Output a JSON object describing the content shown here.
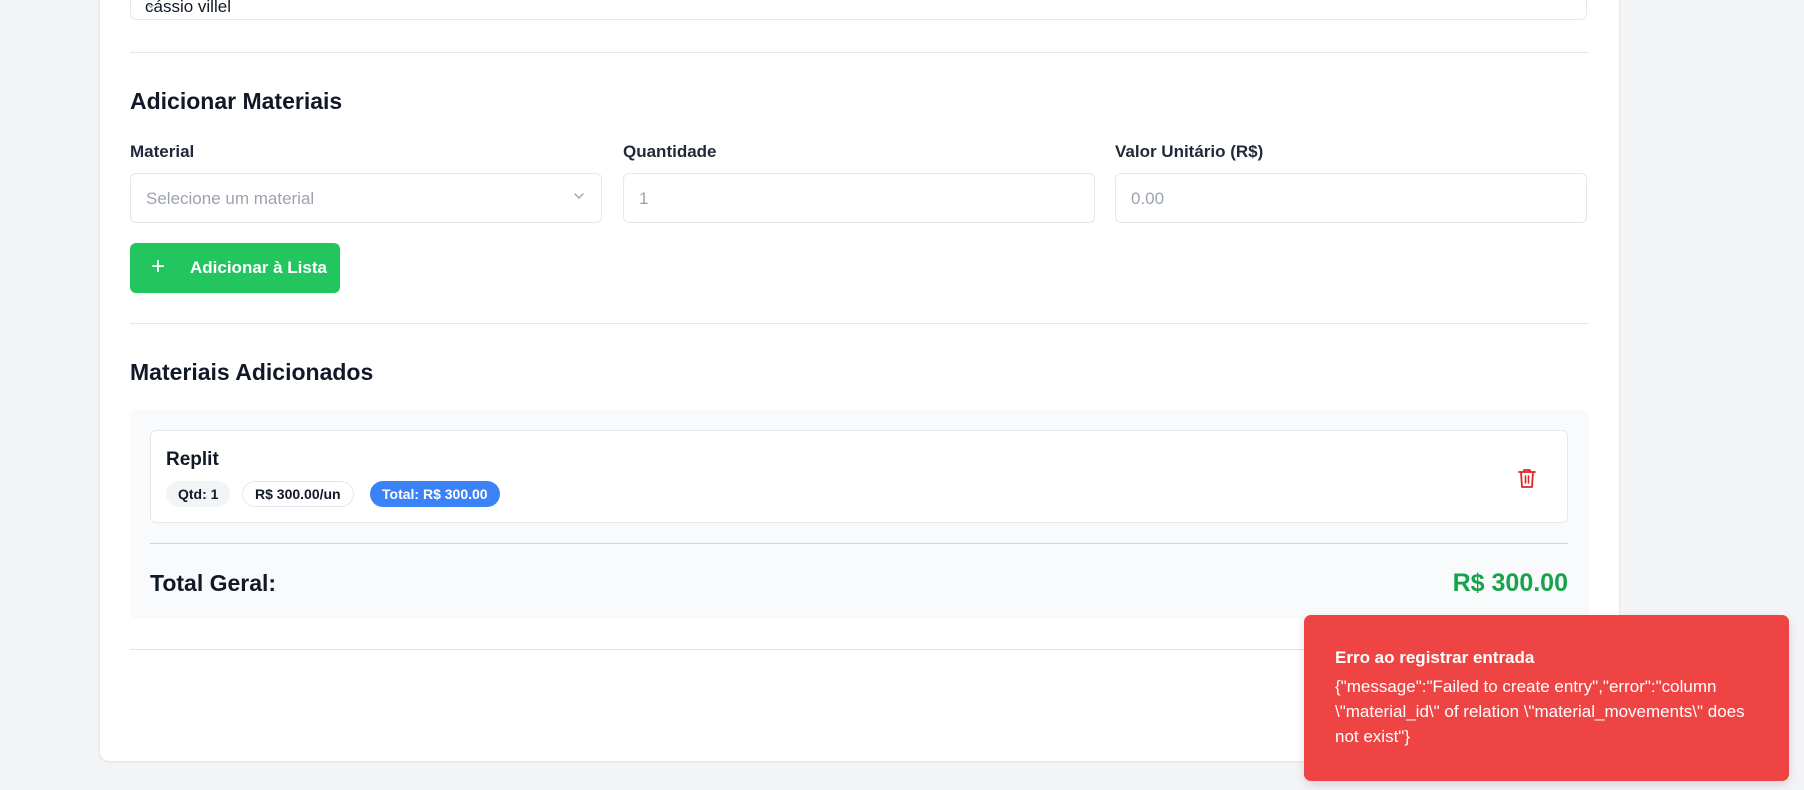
{
  "top_select": {
    "value": "cássio villel"
  },
  "add_section": {
    "title": "Adicionar Materiais",
    "material_label": "Material",
    "material_placeholder": "Selecione um material",
    "quantity_label": "Quantidade",
    "quantity_placeholder": "1",
    "unit_value_label": "Valor Unitário (R$)",
    "unit_value_placeholder": "0.00",
    "add_button_label": "Adicionar à Lista"
  },
  "added_section": {
    "title": "Materiais Adicionados",
    "items": [
      {
        "name": "Replit",
        "qty_badge": "Qtd: 1",
        "unit_badge": "R$ 300.00/un",
        "total_badge": "Total: R$ 300.00"
      }
    ],
    "total_label": "Total Geral:",
    "total_value": "R$ 300.00"
  },
  "toast": {
    "title": "Erro ao registrar entrada",
    "message": "{\"message\":\"Failed to create entry\",\"error\":\"column \\\"material_id\\\" of relation \\\"material_movements\\\" does not exist\"}"
  },
  "colors": {
    "accent_green": "#22c55e",
    "total_green": "#16a34a",
    "badge_blue": "#3b82f6",
    "error_red": "#ef4444",
    "trash_red": "#dc2626"
  },
  "icons": {
    "plus": "plus-icon",
    "chevron": "chevron-down-icon",
    "trash": "trash-icon"
  }
}
